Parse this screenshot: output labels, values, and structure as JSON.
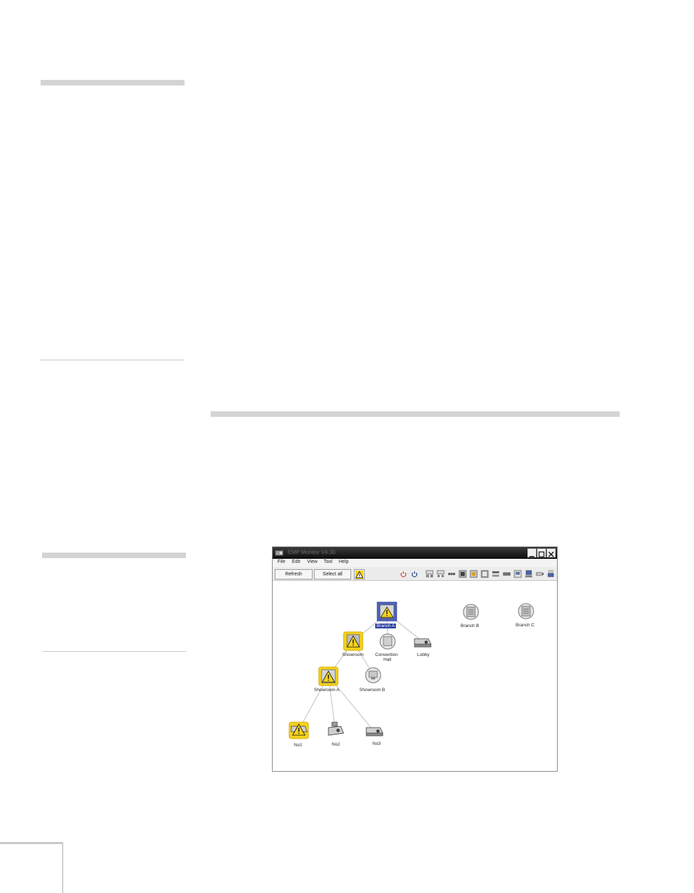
{
  "window": {
    "title": "EMP Monitor  V4.30",
    "menu": [
      "File",
      "Edit",
      "View",
      "Tool",
      "Help"
    ],
    "buttons": {
      "refresh": "Refresh",
      "select_all": "Select all"
    }
  },
  "tree": {
    "nodes": {
      "branch_a": "Branch A",
      "branch_b": "Branch B",
      "branch_c": "Branch C",
      "showroom": "Showroom",
      "convention_hall_1": "Convention",
      "convention_hall_2": "Hall",
      "lobby": "Lobby",
      "showroom_a": "Showroom A",
      "showroom_b": "Showroom B",
      "no1": "No1",
      "no2": "No2",
      "no3": "No3"
    },
    "selected": "Branch A",
    "warning_nodes": [
      "Branch A",
      "Showroom",
      "Showroom A",
      "No1"
    ]
  },
  "colors": {
    "warning_yellow": "#f5d21c",
    "selection_blue": "#2a3fa0",
    "power_red": "#d03030"
  },
  "icons": [
    "app-icon",
    "minimize-icon",
    "maximize-icon",
    "close-icon",
    "warning-icon",
    "power-on-icon",
    "power-off-icon",
    "folder-icon",
    "projector-icon"
  ]
}
